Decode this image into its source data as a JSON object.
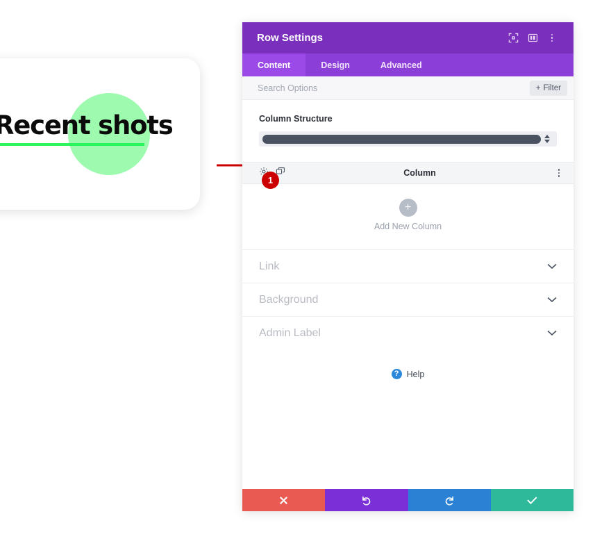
{
  "preview": {
    "heading": "Recent shots",
    "blob_color": "#9dfaaf",
    "underline_color": "#2bf45c"
  },
  "annotation": {
    "badge_number": "1",
    "badge_color": "#cc0000",
    "arrow_color": "#cc0000"
  },
  "panel": {
    "title": "Row Settings",
    "header_color": "#7b30bd",
    "header_icons": [
      {
        "name": "focus-fullscreen-icon",
        "glyph": "focus"
      },
      {
        "name": "split-view-icon",
        "glyph": "split"
      },
      {
        "name": "overflow-menu-icon",
        "glyph": "dots"
      }
    ],
    "tabs": [
      {
        "label": "Content",
        "active": true
      },
      {
        "label": "Design",
        "active": false
      },
      {
        "label": "Advanced",
        "active": false
      }
    ],
    "search": {
      "placeholder": "Search Options",
      "value": ""
    },
    "filter": {
      "label": "Filter",
      "plus": "+"
    },
    "column_structure": {
      "label": "Column Structure",
      "selected_value": "1 Column"
    },
    "column_row": {
      "label": "Column",
      "tools": [
        {
          "name": "gear-icon"
        },
        {
          "name": "duplicate-icon"
        }
      ],
      "menu": "overflow-menu-icon"
    },
    "add_column": {
      "label": "Add New Column",
      "plus": "+"
    },
    "accordions": [
      {
        "label": "Link"
      },
      {
        "label": "Background"
      },
      {
        "label": "Admin Label"
      }
    ],
    "help": {
      "label": "Help",
      "icon_char": "?",
      "icon_color": "#2b87da"
    },
    "footer_buttons": [
      {
        "name": "cancel-button",
        "glyph": "close",
        "color": "#e85a52"
      },
      {
        "name": "undo-button",
        "glyph": "undo",
        "color": "#7b2fd6"
      },
      {
        "name": "redo-button",
        "glyph": "redo",
        "color": "#2b82d4"
      },
      {
        "name": "save-button",
        "glyph": "check",
        "color": "#2eb99b"
      }
    ]
  }
}
